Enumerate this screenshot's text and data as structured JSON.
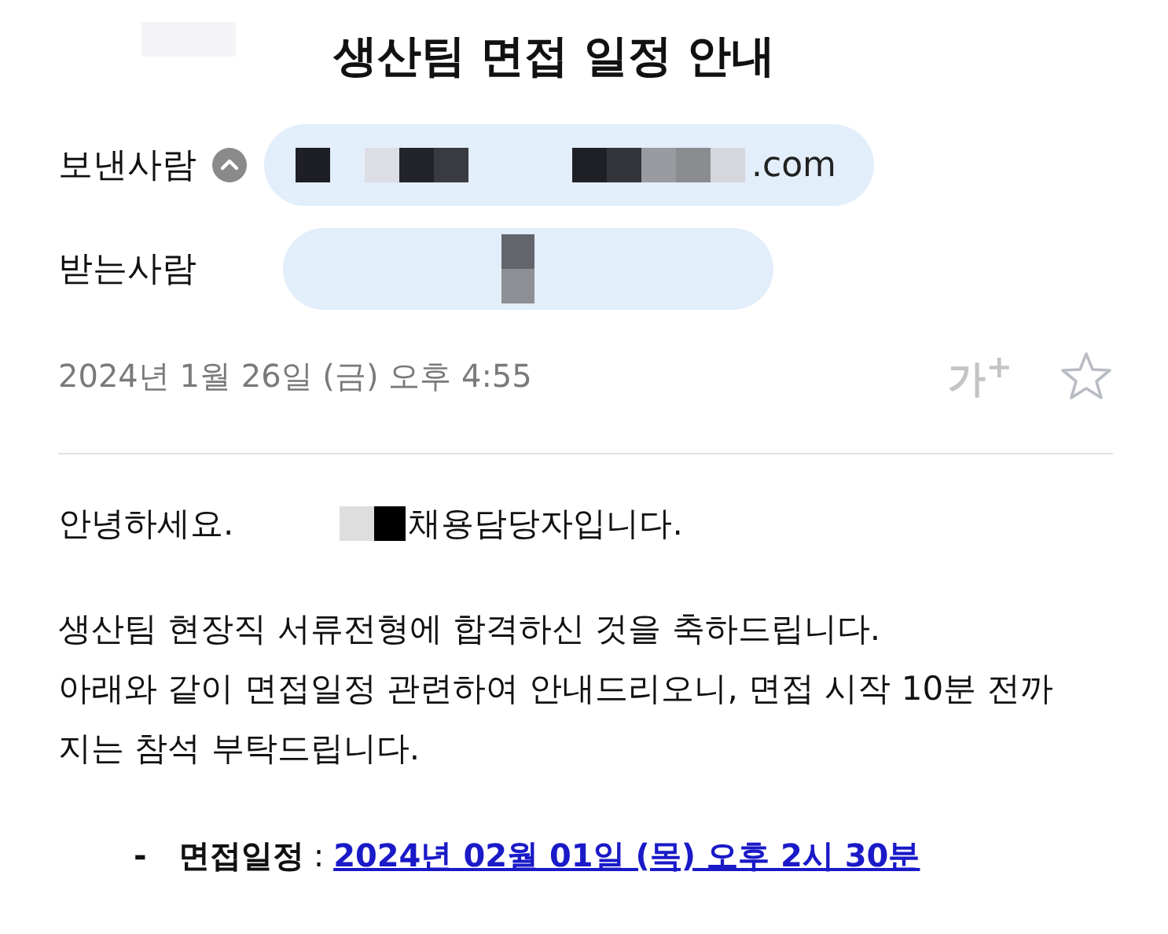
{
  "subject": "생산팀 면접 일정 안내",
  "sender": {
    "label": "보낸사람",
    "expanded": true,
    "address_end": ".com"
  },
  "recipient": {
    "label": "받는사람"
  },
  "date": "2024년 1월 26일 (금) 오후 4:55",
  "font_size_button": "가$^{+}$",
  "starred": false,
  "greeting": {
    "before": "안녕하세요.",
    "after": "채용담당자입니다."
  },
  "paragraph": [
    "생산팀 현장직 서류전형에 합격하신 것을 축하드립니다.",
    "아래와 같이 면접일정 관련하여 안내드리오니, 면접 시작 10분 전까지는 참석 부탁드립니다."
  ],
  "schedule": {
    "bullet": "-",
    "label": "면접일정",
    "separator": ":",
    "link": "2024년 02월 01일 (목) 오후 2시 30분"
  }
}
